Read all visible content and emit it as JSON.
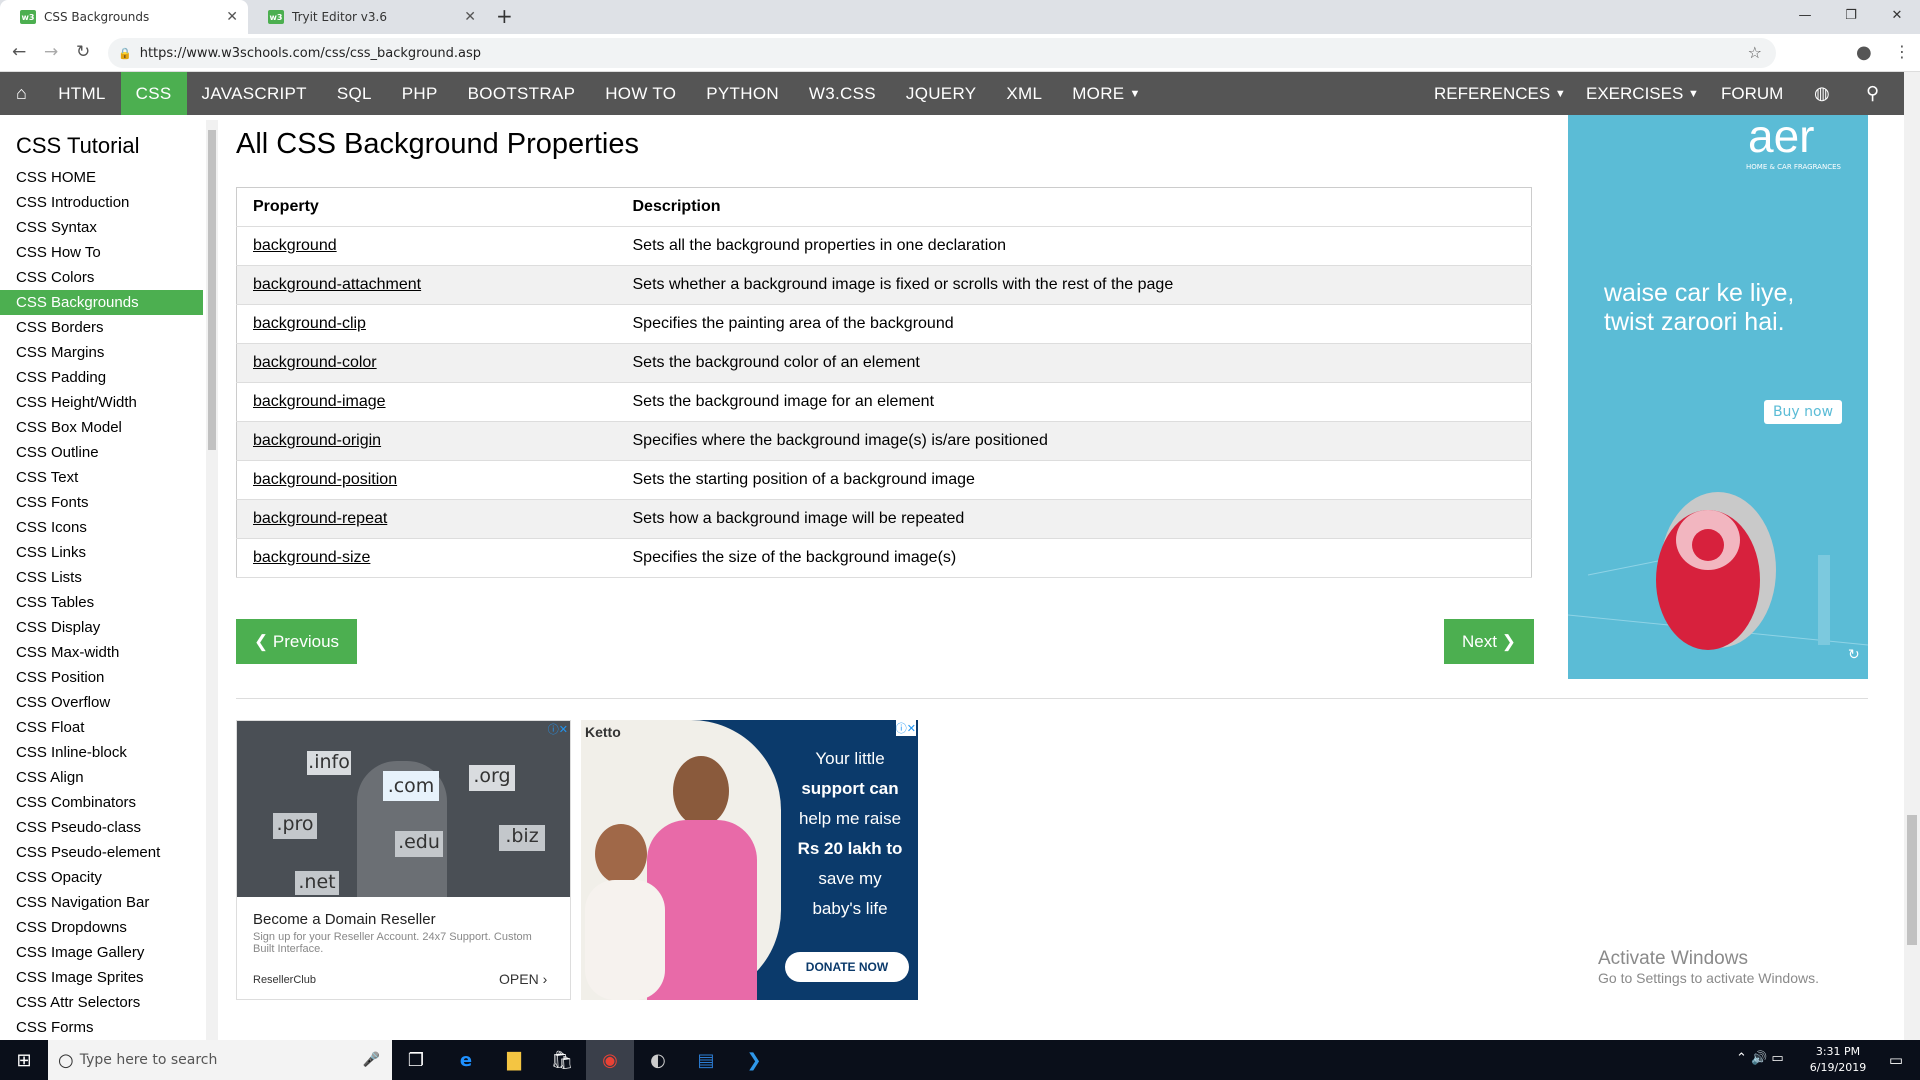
{
  "browser": {
    "tabs": [
      {
        "title": "CSS Backgrounds",
        "favicon": "w3"
      },
      {
        "title": "Tryit Editor v3.6",
        "favicon": "w3"
      }
    ],
    "url": "https://www.w3schools.com/css/css_background.asp"
  },
  "topnav": {
    "items": [
      "HTML",
      "CSS",
      "JAVASCRIPT",
      "SQL",
      "PHP",
      "BOOTSTRAP",
      "HOW TO",
      "PYTHON",
      "W3.CSS",
      "JQUERY",
      "XML",
      "MORE"
    ],
    "right": [
      "REFERENCES",
      "EXERCISES",
      "FORUM"
    ],
    "active": "CSS"
  },
  "sidebar": {
    "title": "CSS Tutorial",
    "links": [
      "CSS HOME",
      "CSS Introduction",
      "CSS Syntax",
      "CSS How To",
      "CSS Colors",
      "CSS Backgrounds",
      "CSS Borders",
      "CSS Margins",
      "CSS Padding",
      "CSS Height/Width",
      "CSS Box Model",
      "CSS Outline",
      "CSS Text",
      "CSS Fonts",
      "CSS Icons",
      "CSS Links",
      "CSS Lists",
      "CSS Tables",
      "CSS Display",
      "CSS Max-width",
      "CSS Position",
      "CSS Overflow",
      "CSS Float",
      "CSS Inline-block",
      "CSS Align",
      "CSS Combinators",
      "CSS Pseudo-class",
      "CSS Pseudo-element",
      "CSS Opacity",
      "CSS Navigation Bar",
      "CSS Dropdowns",
      "CSS Image Gallery",
      "CSS Image Sprites",
      "CSS Attr Selectors",
      "CSS Forms"
    ],
    "active": "CSS Backgrounds"
  },
  "main": {
    "title": "All CSS Background Properties",
    "table": {
      "headers": [
        "Property",
        "Description"
      ],
      "rows": [
        [
          "background",
          "Sets all the background properties in one declaration"
        ],
        [
          "background-attachment",
          "Sets whether a background image is fixed or scrolls with the rest of the page"
        ],
        [
          "background-clip",
          "Specifies the painting area of the background"
        ],
        [
          "background-color",
          "Sets the background color of an element"
        ],
        [
          "background-image",
          "Sets the background image for an element"
        ],
        [
          "background-origin",
          "Specifies where the background image(s) is/are positioned"
        ],
        [
          "background-position",
          "Sets the starting position of a background image"
        ],
        [
          "background-repeat",
          "Sets how a background image will be repeated"
        ],
        [
          "background-size",
          "Specifies the size of the background image(s)"
        ]
      ]
    },
    "prev_label": "❮ Previous",
    "next_label": "Next ❯"
  },
  "ads": {
    "right": {
      "brand": "aer",
      "brand_sub": "HOME & CAR FRAGRANCES",
      "tagline": "waise car ke liye, twist zaroori hai.",
      "cta": "Buy now"
    },
    "domain": {
      "tlds": [
        ".info",
        ".com",
        ".org",
        ".pro",
        ".edu",
        ".biz",
        ".net"
      ],
      "title": "Become a Domain Reseller",
      "desc": "Sign up for your Reseller Account. 24x7 Support. Custom Built Interface.",
      "advertiser": "ResellerClub",
      "cta": "OPEN"
    },
    "ketto": {
      "brand": "Ketto",
      "lines": [
        "Your little",
        "support can",
        "help me raise",
        "Rs 20 lakh to",
        "save my",
        "baby's life"
      ],
      "cta": "DONATE NOW"
    }
  },
  "watermark": {
    "line1": "Activate Windows",
    "line2": "Go to Settings to activate Windows."
  },
  "taskbar": {
    "search_placeholder": "Type here to search",
    "time": "3:31 PM",
    "date": "6/19/2019"
  },
  "colors": {
    "accent": "#4CAF50",
    "nav_bg": "#555555",
    "table_stripe": "#f1f1f1"
  }
}
